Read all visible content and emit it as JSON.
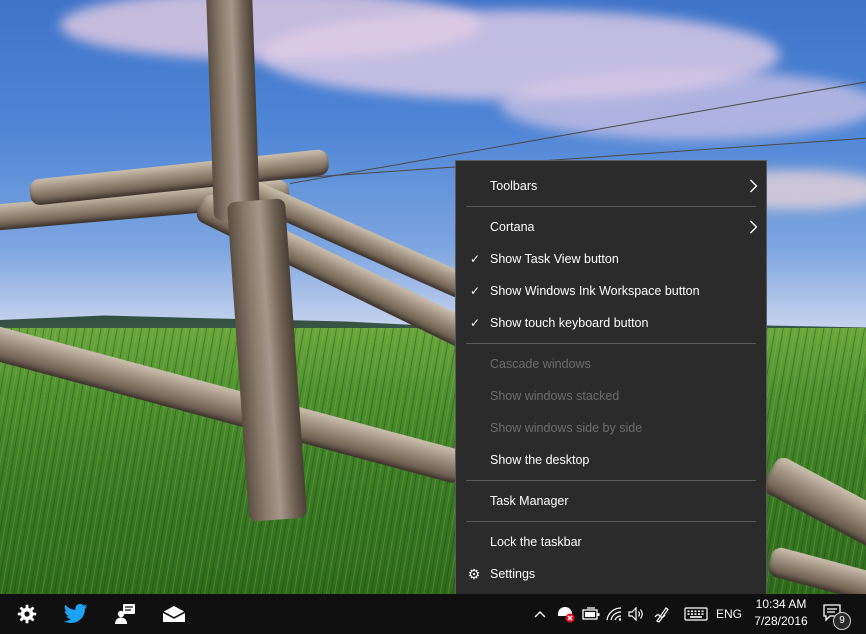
{
  "context_menu": {
    "items": [
      {
        "label": "Toolbars",
        "checked": false,
        "enabled": true,
        "submenu": true,
        "icon": null
      },
      {
        "separator": true
      },
      {
        "label": "Cortana",
        "checked": false,
        "enabled": true,
        "submenu": true,
        "icon": null
      },
      {
        "label": "Show Task View button",
        "checked": true,
        "enabled": true,
        "submenu": false,
        "icon": null
      },
      {
        "label": "Show Windows Ink Workspace button",
        "checked": true,
        "enabled": true,
        "submenu": false,
        "icon": null
      },
      {
        "label": "Show touch keyboard button",
        "checked": true,
        "enabled": true,
        "submenu": false,
        "icon": null
      },
      {
        "separator": true
      },
      {
        "label": "Cascade windows",
        "checked": false,
        "enabled": false,
        "submenu": false,
        "icon": null
      },
      {
        "label": "Show windows stacked",
        "checked": false,
        "enabled": false,
        "submenu": false,
        "icon": null
      },
      {
        "label": "Show windows side by side",
        "checked": false,
        "enabled": false,
        "submenu": false,
        "icon": null
      },
      {
        "label": "Show the desktop",
        "checked": false,
        "enabled": true,
        "submenu": false,
        "icon": null
      },
      {
        "separator": true
      },
      {
        "label": "Task Manager",
        "checked": false,
        "enabled": true,
        "submenu": false,
        "icon": null
      },
      {
        "separator": true
      },
      {
        "label": "Lock the taskbar",
        "checked": false,
        "enabled": true,
        "submenu": false,
        "icon": null
      },
      {
        "label": "Settings",
        "checked": false,
        "enabled": true,
        "submenu": false,
        "icon": "gear-icon"
      }
    ]
  },
  "taskbar": {
    "pinned": [
      {
        "name": "settings-gear-icon"
      },
      {
        "name": "twitter-bird-icon"
      },
      {
        "name": "people-contacts-icon"
      },
      {
        "name": "mail-envelope-icon"
      }
    ],
    "tray": {
      "icons": [
        "chevron-up-icon",
        "security-alert-icon",
        "battery-icon",
        "wifi-icon",
        "volume-icon",
        "windows-ink-pen-icon",
        "touch-keyboard-icon"
      ],
      "language": "ENG",
      "time": "10:34 AM",
      "date": "7/28/2016",
      "notification_count": "9"
    }
  },
  "colors": {
    "menu_bg": "#2b2b2b",
    "menu_text": "#ffffff",
    "menu_disabled": "#6d6d6d",
    "taskbar_bg": "#101010",
    "twitter_blue": "#1da1f2",
    "security_red": "#e81123"
  }
}
